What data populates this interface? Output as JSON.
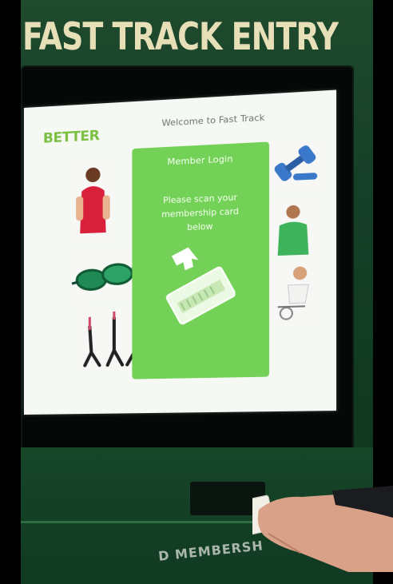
{
  "kiosk": {
    "header": "FAST TRACK ENTRY",
    "bottom_label": "D MEMBERSH"
  },
  "screen": {
    "logo": "BETTER",
    "welcome": "Welcome to Fast Track",
    "panel": {
      "title": "Member Login",
      "message": "Please scan your membership card below"
    }
  },
  "colors": {
    "kiosk_green": "#17402a",
    "panel_green": "#73d157",
    "logo_green": "#7bc043",
    "header_text": "#e6dfb8"
  }
}
